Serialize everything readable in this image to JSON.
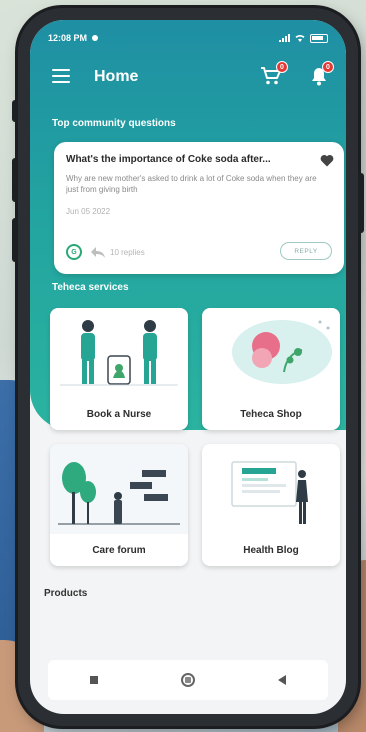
{
  "status_bar": {
    "time": "12:08 PM"
  },
  "app_bar": {
    "title": "Home",
    "cart_badge": "0",
    "notification_badge": "0"
  },
  "community": {
    "section_title": "Top community questions",
    "question": {
      "title": "What's the importance of Coke soda after...",
      "body": "Why are new mother's asked to drink a lot of Coke soda when they are just from giving birth",
      "date": "Jun 05 2022",
      "avatar_initial": "G",
      "replies": "10 replies",
      "reply_button": "REPLY"
    }
  },
  "services": {
    "section_title": "Teheca services",
    "items": [
      {
        "label": "Book a Nurse"
      },
      {
        "label": "Teheca Shop"
      },
      {
        "label": "Care forum"
      },
      {
        "label": "Health Blog"
      }
    ]
  },
  "products": {
    "section_title": "Products"
  },
  "colors": {
    "teal_top": "#1f8fa4",
    "teal_bottom": "#2bb3a0",
    "badge_red": "#e53935",
    "card_bg": "#ffffff"
  }
}
